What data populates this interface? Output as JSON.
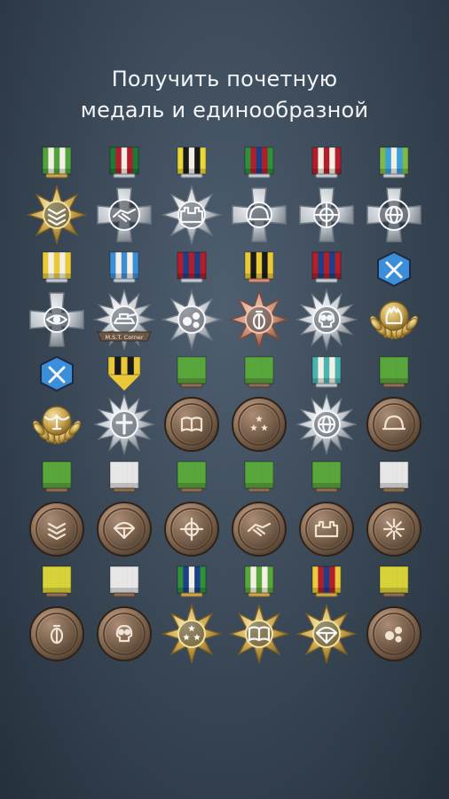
{
  "headline": {
    "line1": "Получить почетную",
    "line2": "медаль и единообразной"
  },
  "palette": {
    "background": "#3c4a59",
    "text": "#f2f4f6",
    "bronze": "#8a6e56",
    "silver": "#c9ced3",
    "gold": "#c9a54e"
  },
  "medals": [
    {
      "ribbon": [
        "#4fa33a",
        "#f4f0e6",
        "#4fa33a",
        "#f4f0e6",
        "#4fa33a"
      ],
      "shape": "star8",
      "metal": "gold",
      "emblem": "chevrons-icon"
    },
    {
      "ribbon": [
        "#1f7a3a",
        "#b21f2b",
        "#f4f0e6",
        "#b21f2b",
        "#1f7a3a"
      ],
      "shape": "cross-round",
      "metal": "silver",
      "emblem": "handshake-icon"
    },
    {
      "ribbon": [
        "#e9d83a",
        "#1a1a1a",
        "#f4f0e6",
        "#1a1a1a",
        "#e9d83a"
      ],
      "shape": "star8",
      "metal": "silver",
      "emblem": "fortress-icon"
    },
    {
      "ribbon": [
        "#2f8f3a",
        "#b21f2b",
        "#1c3f8a",
        "#b21f2b",
        "#2f8f3a"
      ],
      "shape": "cross",
      "metal": "silver",
      "emblem": "helmet-icon"
    },
    {
      "ribbon": [
        "#b21f2b",
        "#f4f0e6",
        "#b21f2b",
        "#f4f0e6",
        "#b21f2b"
      ],
      "shape": "cross",
      "metal": "silver",
      "emblem": "crosshair-icon"
    },
    {
      "ribbon": [
        "#7fb84a",
        "#3aa0d8",
        "#f4f0e6",
        "#3aa0d8",
        "#7fb84a"
      ],
      "shape": "cross-round",
      "metal": "silver",
      "emblem": "globe-icon"
    },
    {
      "ribbon": [
        "#e9c83a",
        "#f4f0e6",
        "#e9c83a",
        "#f4f0e6",
        "#e9c83a"
      ],
      "shape": "cross",
      "metal": "silver",
      "emblem": "eye-icon"
    },
    {
      "ribbon": [
        "#3a8fd8",
        "#f4f0e6",
        "#3a8fd8",
        "#f4f0e6",
        "#3a8fd8"
      ],
      "shape": "star12",
      "metal": "silver",
      "emblem": "tank-icon",
      "banner": "M.S.T. Corner"
    },
    {
      "ribbon": [
        "#b21f2b",
        "#1c3f8a",
        "#b21f2b",
        "#1c3f8a",
        "#b21f2b"
      ],
      "shape": "star8",
      "metal": "silver",
      "emblem": "bullet-holes-icon"
    },
    {
      "ribbon": [
        "#e9c83a",
        "#1a1a1a",
        "#e9c83a",
        "#1a1a1a",
        "#e9c83a"
      ],
      "shape": "star8",
      "metal": "copper",
      "emblem": "grenade-icon"
    },
    {
      "ribbon": [
        "#b21f2b",
        "#1c3f8a",
        "#b21f2b",
        "#1c3f8a",
        "#b21f2b"
      ],
      "shape": "star12",
      "metal": "silver",
      "emblem": "skull-icon"
    },
    {
      "ribbon": [
        "#3a8fd8",
        "#3a8fd8",
        "#3a8fd8",
        "#3a8fd8",
        "#3a8fd8"
      ],
      "shape": "wreath",
      "metal": "gold",
      "emblem": "flames-icon",
      "hexTop": true
    },
    {
      "ribbon": [
        "#3a8fd8",
        "#3a8fd8",
        "#3a8fd8",
        "#3a8fd8",
        "#3a8fd8"
      ],
      "shape": "wreath",
      "metal": "gold",
      "emblem": "eagle-icon",
      "hexTop": true
    },
    {
      "ribbon": [
        "#e9c83a",
        "#1a1a1a",
        "#e9c83a",
        "#1a1a1a",
        "#e9c83a"
      ],
      "shape": "star12",
      "metal": "silver",
      "emblem": "cross-icon",
      "pennant": true
    },
    {
      "ribbon": [
        "#59a63c",
        "#59a63c",
        "#59a63c",
        "#59a63c",
        "#59a63c"
      ],
      "shape": "disc",
      "metal": "bronze",
      "emblem": "book-icon"
    },
    {
      "ribbon": [
        "#59a63c",
        "#59a63c",
        "#59a63c",
        "#59a63c",
        "#59a63c"
      ],
      "shape": "disc",
      "metal": "bronze",
      "emblem": "stars-icon"
    },
    {
      "ribbon": [
        "#49b3b0",
        "#f4f0e6",
        "#49b3b0",
        "#f4f0e6",
        "#49b3b0"
      ],
      "shape": "star12",
      "metal": "silver",
      "emblem": "globe-icon"
    },
    {
      "ribbon": [
        "#59a63c",
        "#59a63c",
        "#59a63c",
        "#59a63c",
        "#59a63c"
      ],
      "shape": "disc",
      "metal": "bronze",
      "emblem": "helmet-icon"
    },
    {
      "ribbon": [
        "#59a63c",
        "#59a63c",
        "#59a63c",
        "#59a63c",
        "#59a63c"
      ],
      "shape": "disc",
      "metal": "bronze",
      "emblem": "chevrons-icon"
    },
    {
      "ribbon": [
        "#e6e6e6",
        "#e6e6e6",
        "#e6e6e6",
        "#e6e6e6",
        "#e6e6e6"
      ],
      "shape": "disc",
      "metal": "bronze",
      "emblem": "parachute-icon"
    },
    {
      "ribbon": [
        "#59a63c",
        "#59a63c",
        "#59a63c",
        "#59a63c",
        "#59a63c"
      ],
      "shape": "disc",
      "metal": "bronze",
      "emblem": "crosshair-icon"
    },
    {
      "ribbon": [
        "#59a63c",
        "#59a63c",
        "#59a63c",
        "#59a63c",
        "#59a63c"
      ],
      "shape": "disc",
      "metal": "bronze",
      "emblem": "handshake-icon"
    },
    {
      "ribbon": [
        "#59a63c",
        "#59a63c",
        "#59a63c",
        "#59a63c",
        "#59a63c"
      ],
      "shape": "disc",
      "metal": "bronze",
      "emblem": "fortress-icon"
    },
    {
      "ribbon": [
        "#e6e6e6",
        "#e6e6e6",
        "#e6e6e6",
        "#e6e6e6",
        "#e6e6e6"
      ],
      "shape": "disc",
      "metal": "bronze",
      "emblem": "burst-icon"
    },
    {
      "ribbon": [
        "#d8d23a",
        "#d8d23a",
        "#d8d23a",
        "#d8d23a",
        "#d8d23a"
      ],
      "shape": "disc",
      "metal": "bronze",
      "emblem": "grenade-icon"
    },
    {
      "ribbon": [
        "#e6e6e6",
        "#e6e6e6",
        "#e6e6e6",
        "#e6e6e6",
        "#e6e6e6"
      ],
      "shape": "disc",
      "metal": "bronze",
      "emblem": "skull-icon"
    },
    {
      "ribbon": [
        "#2f8f3a",
        "#1c3f8a",
        "#f4f0e6",
        "#1c3f8a",
        "#2f8f3a"
      ],
      "shape": "star8",
      "metal": "gold",
      "emblem": "stars-icon"
    },
    {
      "ribbon": [
        "#59a63c",
        "#f4f0e6",
        "#59a63c",
        "#f4f0e6",
        "#59a63c"
      ],
      "shape": "star8",
      "metal": "gold",
      "emblem": "book-icon"
    },
    {
      "ribbon": [
        "#e9c83a",
        "#b21f2b",
        "#1c3f8a",
        "#b21f2b",
        "#e9c83a"
      ],
      "shape": "star8",
      "metal": "gold",
      "emblem": "parachute-icon"
    },
    {
      "ribbon": [
        "#d8d23a",
        "#d8d23a",
        "#d8d23a",
        "#d8d23a",
        "#d8d23a"
      ],
      "shape": "disc",
      "metal": "bronze",
      "emblem": "bullet-holes-icon"
    }
  ]
}
